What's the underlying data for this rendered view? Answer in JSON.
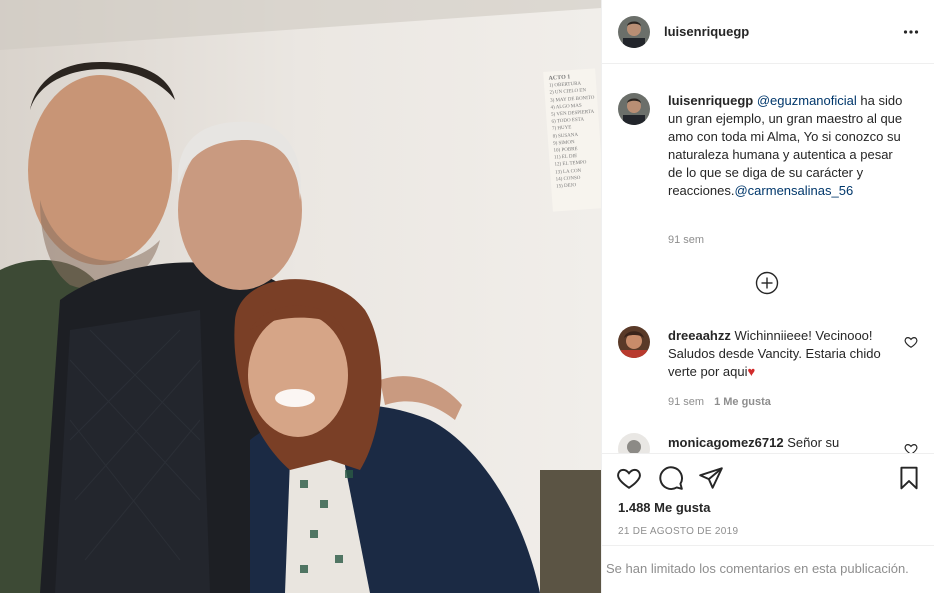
{
  "post": {
    "username": "luisenriquegp",
    "caption": {
      "mention1": "@eguzmanoficial",
      "text": " ha sido un gran ejemplo, un gran maestro al que amo con toda mi Alma, Yo si conozco su naturaleza humana y autentica a pesar de lo que se diga de su carácter y reacciones.",
      "mention2": "@carmensalinas_56",
      "time": "91 sem"
    },
    "likes": "1.488 Me gusta",
    "date": "21 DE AGOSTO DE 2019",
    "comments_limited": "Se han limitado los comentarios en esta publicación."
  },
  "comments": [
    {
      "username": "dreeaahzz",
      "text": " Wichinniieee! Vecinooo! Saludos desde Vancity. Estaria chido verte por aqui",
      "emoji": "♥",
      "time": "91 sem",
      "likes": "1 Me gusta"
    },
    {
      "username": "monicagomez6712",
      "text": " Señor su"
    }
  ],
  "wall_sign": {
    "title": "ACTO 1",
    "lines": [
      "1) OBERTURA",
      "2) UN CIELO EN",
      "3) MAY DE BONITO",
      "4) ALGO MAS",
      "5) VEN DESPIERTA",
      "6) TODO ESTA",
      "7) HUYE",
      "8) SUSANA",
      "9) SIMON",
      "10) POBRE",
      "11) EL DIE",
      "12) EL TEMPO",
      "13) LA CON",
      "14) CONSO",
      "15) DEJO"
    ]
  },
  "icons": {
    "more": "more-options-icon",
    "plus": "load-more-comments-icon",
    "like": "heart-icon",
    "comment": "comment-bubble-icon",
    "share": "paper-plane-icon",
    "save": "bookmark-icon"
  },
  "colors": {
    "link": "#00376b",
    "muted": "#8e8e8e",
    "heart_red": "#ed4956"
  }
}
